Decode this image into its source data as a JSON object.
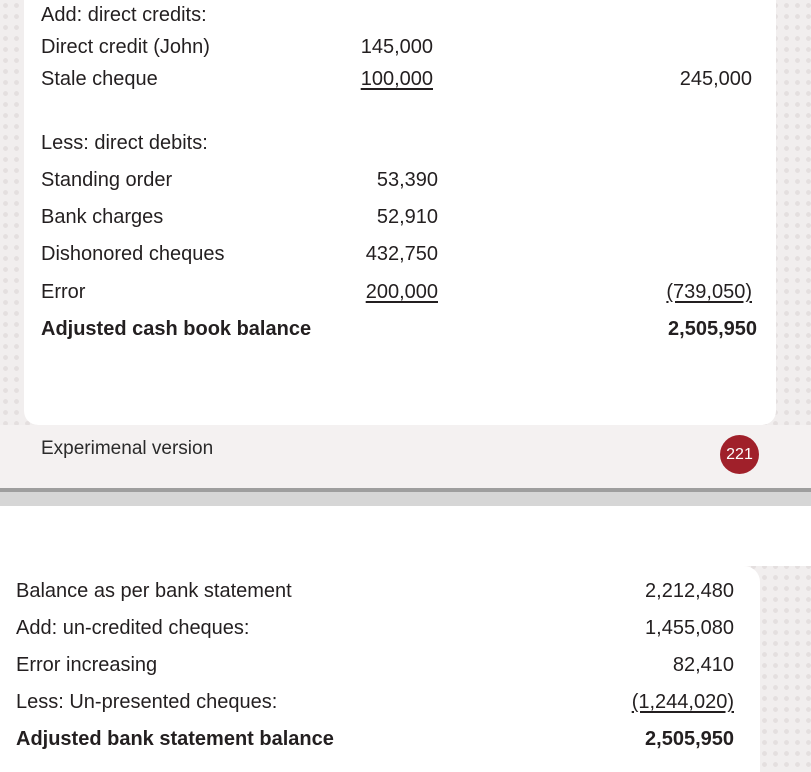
{
  "top_section": {
    "add_direct_credits": {
      "heading": "Add: direct credits:",
      "items": [
        {
          "label": "Direct credit (John)",
          "amount": "145,000"
        },
        {
          "label": "Stale cheque",
          "amount": "100,000"
        }
      ],
      "total": "245,000"
    },
    "less_direct_debits": {
      "heading": "Less: direct debits:",
      "items": [
        {
          "label": "Standing order",
          "amount": "53,390"
        },
        {
          "label": "Bank charges",
          "amount": "52,910"
        },
        {
          "label": "Dishonored cheques",
          "amount": "432,750"
        },
        {
          "label": "Error",
          "amount": "200,000"
        }
      ],
      "total": "(739,050)"
    },
    "adjusted_cash_book": {
      "label": "Adjusted cash book balance",
      "amount": "2,505,950"
    }
  },
  "footer": {
    "label": "Experimenal version",
    "page_number": "221",
    "badge_color": "#a0202a"
  },
  "bottom_section": {
    "rows": [
      {
        "label": "Balance as per bank statement",
        "amount": "2,212,480"
      },
      {
        "label": "Add: un-credited cheques:",
        "amount": "1,455,080"
      },
      {
        "label": "Error increasing",
        "amount": "82,410"
      },
      {
        "label": "Less: Un-presented cheques:",
        "amount": "(1,244,020)"
      }
    ],
    "total": {
      "label": "Adjusted bank statement balance",
      "amount": "2,505,950"
    }
  }
}
